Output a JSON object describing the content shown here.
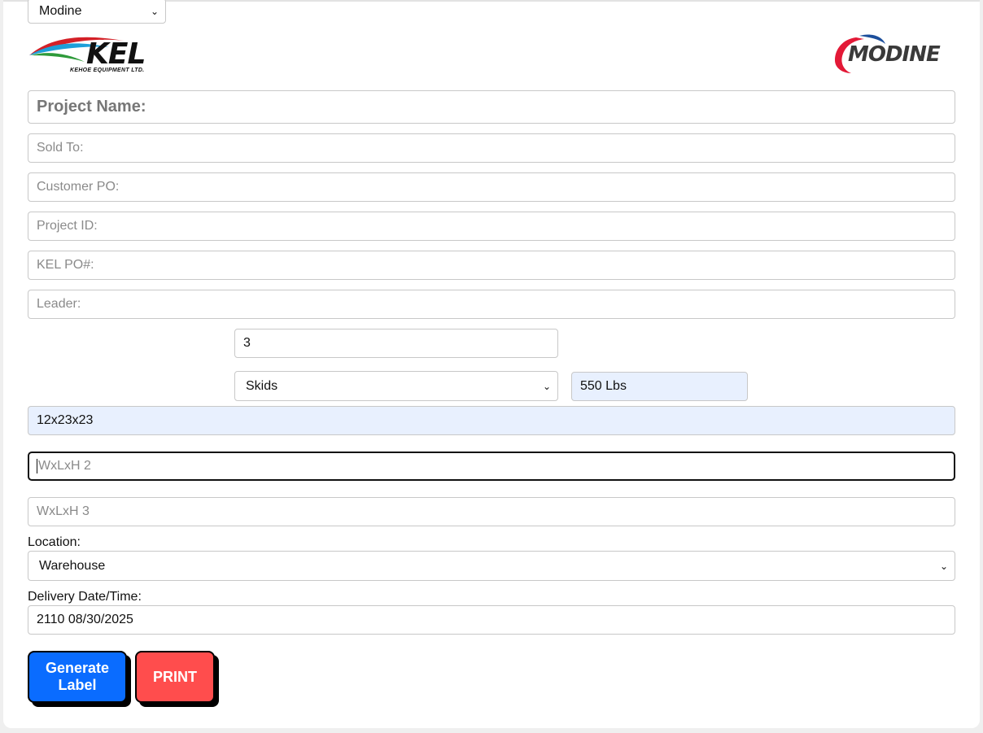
{
  "company_select": {
    "value": "Modine"
  },
  "logos": {
    "left": {
      "text": "KEL",
      "subtext": "KEHOE EQUIPMENT LTD."
    },
    "right": {
      "text": "MODINE"
    }
  },
  "form": {
    "project_name_placeholder": "Project Name:",
    "sold_to_placeholder": "Sold To:",
    "customer_po_placeholder": "Customer PO:",
    "project_id_placeholder": "Project ID:",
    "kel_po_placeholder": "KEL PO#:",
    "leader_placeholder": "Leader:",
    "quantity_value": "3",
    "package_type_value": "Skids",
    "weight_value": "550 Lbs",
    "dims1_value": "12x23x23",
    "dims2_placeholder": "WxLxH 2",
    "dims3_placeholder": "WxLxH 3",
    "location_label": "Location:",
    "location_value": "Warehouse",
    "delivery_label": "Delivery Date/Time:",
    "delivery_value": "2110 08/30/2025"
  },
  "buttons": {
    "generate_label": "Generate Label",
    "print": "PRINT"
  },
  "colors": {
    "generate_bg": "#0a6cff",
    "print_bg": "#ff4d4d",
    "autofill_bg": "#e8f0fe",
    "kel_red": "#d42027",
    "kel_green": "#2e9a3a",
    "kel_blue": "#1d9fd8",
    "modine_red": "#e31937",
    "modine_blue": "#1c4f9c"
  }
}
